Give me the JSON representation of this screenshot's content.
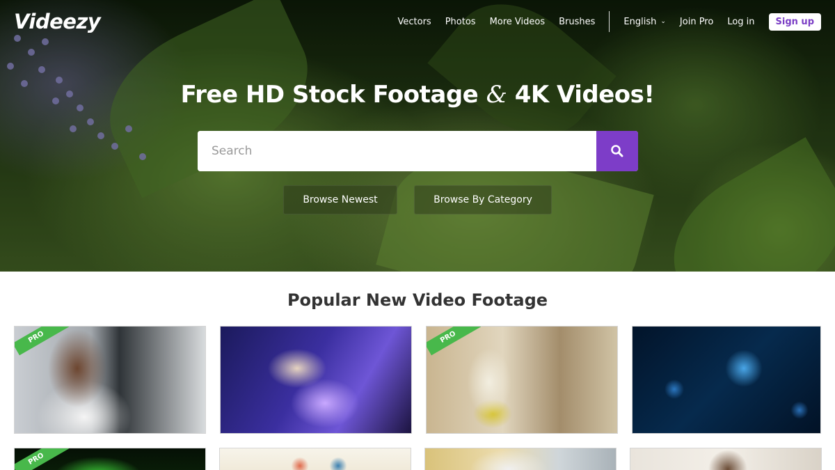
{
  "header": {
    "logo": "Videezy",
    "nav": {
      "vectors": "Vectors",
      "photos": "Photos",
      "more_videos": "More Videos",
      "brushes": "Brushes",
      "language": "English",
      "join_pro": "Join Pro",
      "log_in": "Log in",
      "sign_up": "Sign up"
    }
  },
  "hero": {
    "title_start": "Free HD Stock Footage ",
    "title_amp": "&",
    "title_end": " 4K Videos!",
    "search": {
      "placeholder": "Search",
      "value": "",
      "button_icon": "search-icon"
    },
    "browse_newest": "Browse Newest",
    "browse_category": "Browse By Category"
  },
  "main": {
    "section_title": "Popular New Video Footage",
    "badge_label": "PRO",
    "thumbnails": [
      {
        "description_icon": "scientist-microscope",
        "pro": true
      },
      {
        "description_icon": "lab-pipette",
        "pro": false
      },
      {
        "description_icon": "lab-flask",
        "pro": true
      },
      {
        "description_icon": "virus-cells",
        "pro": false
      },
      {
        "description_icon": "green-glow",
        "pro": true
      },
      {
        "description_icon": "illustration",
        "pro": false
      },
      {
        "description_icon": "lab-bench",
        "pro": false
      },
      {
        "description_icon": "person-room",
        "pro": false
      }
    ]
  },
  "colors": {
    "accent": "#7d3dc8",
    "pro_badge": "#48b84b",
    "signup_text": "#7a3dc5"
  }
}
